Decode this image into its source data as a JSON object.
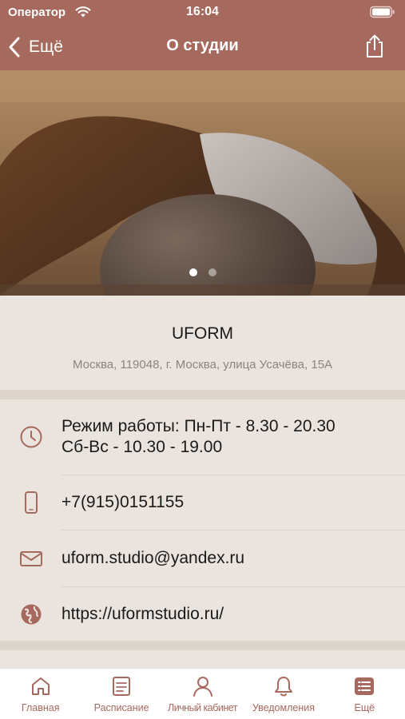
{
  "status_bar": {
    "carrier": "Оператор",
    "time": "16:04"
  },
  "nav": {
    "back_label": "Ещё",
    "title": "О студии"
  },
  "gallery": {
    "page_count": 2,
    "current_page": 1
  },
  "studio": {
    "name": "UFORM",
    "address": "Москва, 119048, г. Москва,  улица Усачёва, 15А"
  },
  "contacts": {
    "hours_line1": "Режим работы: Пн-Пт - 8.30 - 20.30",
    "hours_line2": "Сб-Вс - 10.30 - 19.00",
    "phone": "+7(915)0151155",
    "email": "uform.studio@yandex.ru",
    "website": "https://uformstudio.ru/"
  },
  "tabs": [
    {
      "label": "Главная",
      "icon": "home-icon"
    },
    {
      "label": "Расписание",
      "icon": "schedule-icon"
    },
    {
      "label": "Личный кабинет",
      "icon": "profile-icon"
    },
    {
      "label": "Уведомления",
      "icon": "bell-icon"
    },
    {
      "label": "Ещё",
      "icon": "more-list-icon"
    }
  ],
  "colors": {
    "accent": "#a6695e",
    "background": "#ebe4de",
    "separator": "#ddd4cc",
    "text_secondary": "#8a8480"
  }
}
